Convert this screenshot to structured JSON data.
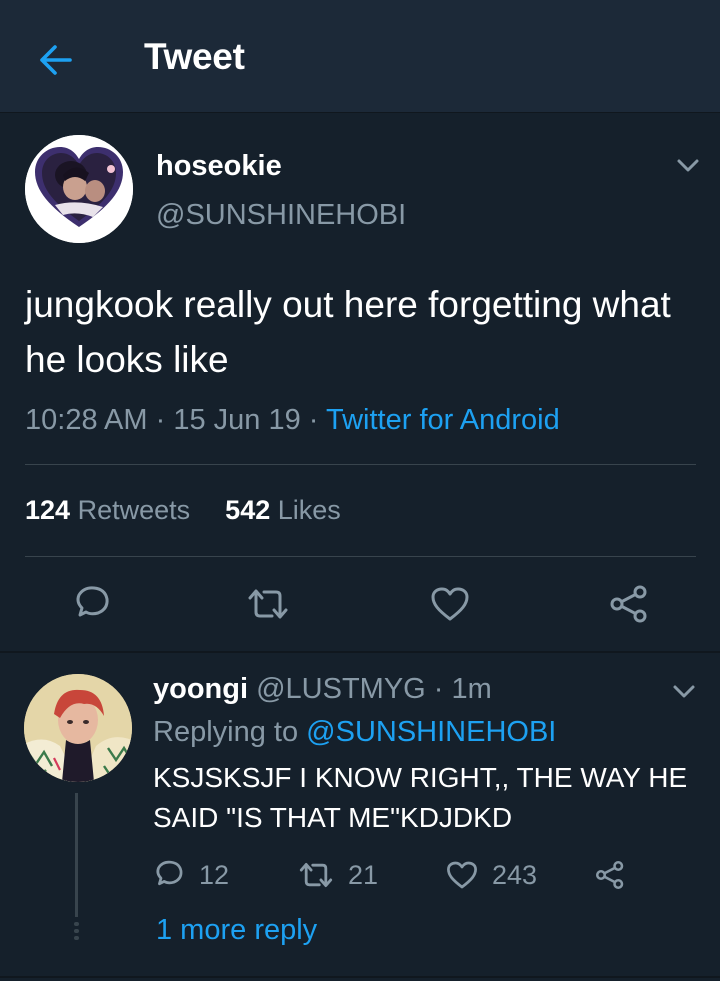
{
  "header": {
    "title": "Tweet"
  },
  "tweet": {
    "display_name": "hoseokie",
    "handle": "@SUNSHINEHOBI",
    "text": "jungkook really out here forgetting what he looks like",
    "time": "10:28 AM",
    "date": "15 Jun 19",
    "separator": "·",
    "source": "Twitter for Android",
    "retweets_count": "124",
    "retweets_label": "Retweets",
    "likes_count": "542",
    "likes_label": "Likes"
  },
  "reply": {
    "display_name": "yoongi",
    "handle": "@LUSTMYG",
    "separator": "·",
    "time": "1m",
    "replying_to_label": "Replying to",
    "replying_to_handle": "@SUNSHINEHOBI",
    "text": "KSJSKSJF I KNOW RIGHT,, THE WAY HE SAID \"IS THAT ME\"KDJDKD",
    "reply_count": "12",
    "retweet_count": "21",
    "like_count": "243",
    "more_replies": "1 more reply"
  },
  "colors": {
    "background": "#15202b",
    "header_bg": "#1c2938",
    "accent": "#1da1f2",
    "secondary_text": "#8899a6",
    "divider": "#38444d"
  },
  "icons": {
    "back": "arrow-left-icon",
    "caret": "chevron-down-icon",
    "reply": "speech-bubble-icon",
    "retweet": "retweet-arrows-icon",
    "like": "heart-icon",
    "share": "share-nodes-icon"
  }
}
